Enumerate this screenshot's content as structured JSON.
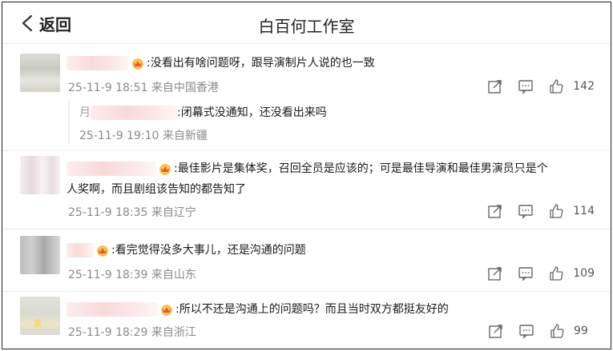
{
  "header": {
    "back_label": "返回",
    "title": "白百何工作室"
  },
  "comments": [
    {
      "text": ":没看出有啥问题呀，跟导演制片人说的也一致",
      "time": "25-11-9 18:51",
      "location": "来自中国香港",
      "likes": "142",
      "reply": {
        "name_prefix": "月",
        "text": ":闭幕式没通知，还没看出来吗",
        "time": "25-11-9 19:10",
        "location": "来自新疆"
      }
    },
    {
      "text_line1": ":最佳影片是集体奖，召回全员是应该的；可是最佳导演和最佳男演员只是个",
      "text_line2": "人奖啊，而且剧组该告知的都告知了",
      "time": "25-11-9 18:35",
      "location": "来自辽宁",
      "likes": "114"
    },
    {
      "text": ":看完觉得没多大事儿，还是沟通的问题",
      "time": "25-11-9 18:39",
      "location": "来自山东",
      "likes": "109"
    },
    {
      "text": ":所以不还是沟通上的问题吗？而且当时双方都挺友好的",
      "time": "25-11-9 18:29",
      "location": "来自浙江",
      "likes": "99"
    }
  ],
  "icons": {
    "back": "chevron-left-icon",
    "share": "share-icon",
    "comment": "comment-icon",
    "like": "thumbs-up-icon",
    "badge": "crown-badge-icon"
  },
  "colors": {
    "text": "#1a1a1a",
    "meta": "#8a8a8a",
    "divider": "#ececec",
    "badge": "#f5a623"
  }
}
